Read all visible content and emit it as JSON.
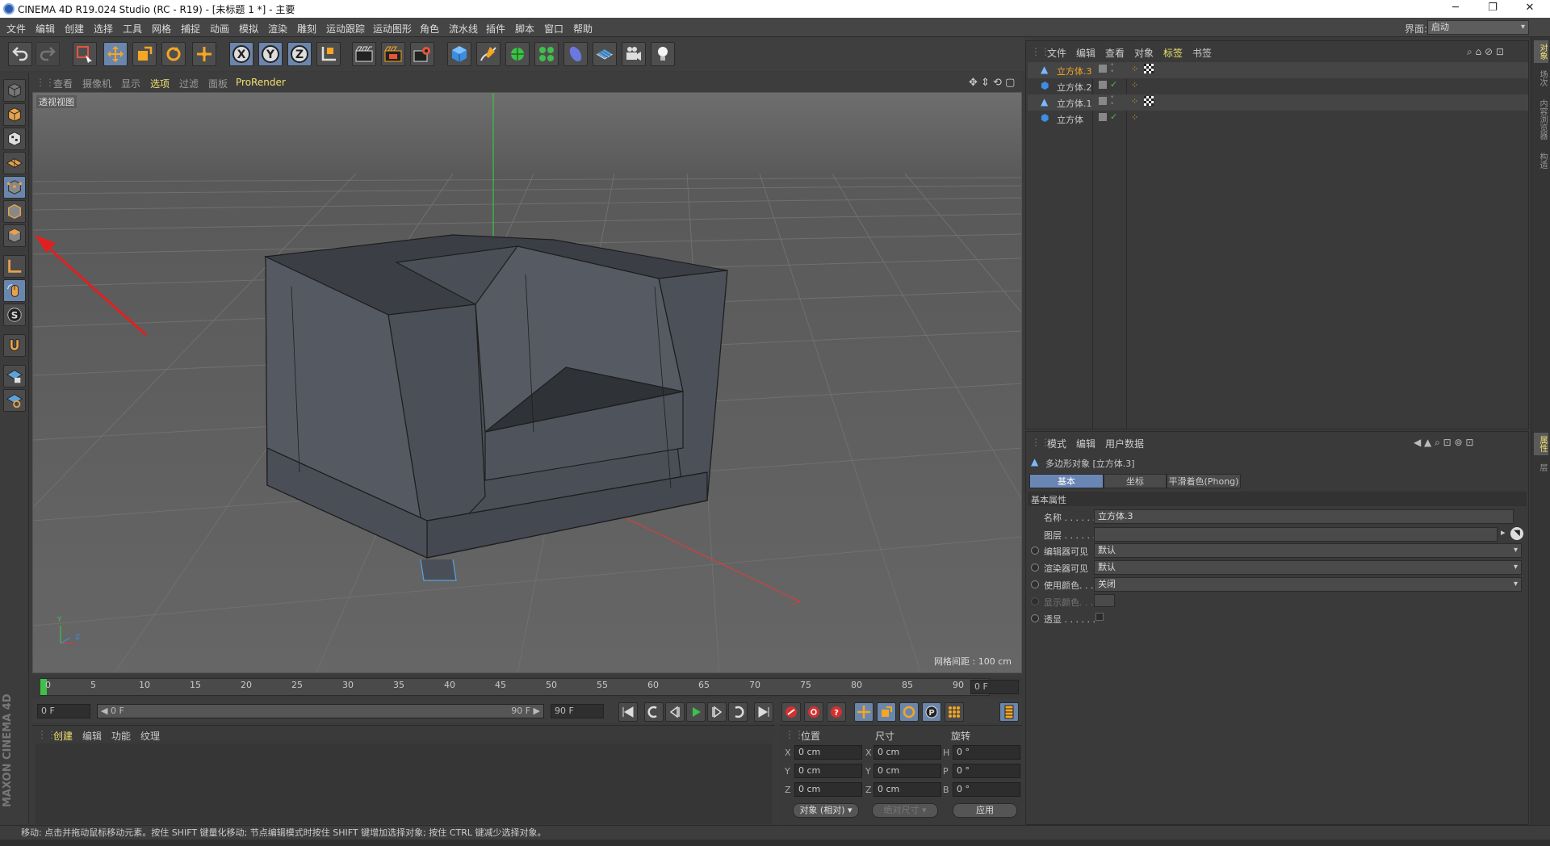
{
  "window": {
    "title": "CINEMA 4D R19.024 Studio (RC - R19) - [未标题 1 *] - 主要",
    "minimize": "─",
    "maximize": "❐",
    "close": "✕"
  },
  "menu": {
    "items": [
      "文件",
      "编辑",
      "创建",
      "选择",
      "工具",
      "网格",
      "捕捉",
      "动画",
      "模拟",
      "渲染",
      "雕刻",
      "运动跟踪",
      "运动图形",
      "角色",
      "流水线",
      "插件",
      "脚本",
      "窗口",
      "帮助"
    ],
    "layout_label": "界面:",
    "layout_value": "启动"
  },
  "toolbar": {
    "icons": [
      "undo-icon",
      "redo-icon",
      "live-selection-icon",
      "move-icon",
      "scale-icon",
      "rotate-icon",
      "recent-tool-icon",
      "x-axis-lock-icon",
      "y-axis-lock-icon",
      "z-axis-lock-icon",
      "coordinate-system-icon",
      "render-view-icon",
      "render-picture-viewer-icon",
      "render-settings-icon",
      "cube-primitive-icon",
      "pen-spline-icon",
      "subdivision-generator-icon",
      "cloner-icon",
      "deformer-icon",
      "floor-icon",
      "camera-icon",
      "light-icon"
    ],
    "axis_x": "X",
    "axis_y": "Y",
    "axis_z": "Z"
  },
  "left_tools": {
    "icons": [
      "make-editable-icon",
      "model-mode-icon",
      "texture-mode-icon",
      "workplane-icon",
      "points-mode-icon",
      "edges-mode-icon",
      "polygons-mode-icon",
      "enable-axis-icon",
      "tweak-mode-icon",
      "solo-icon",
      "snap-icon",
      "lock-workplane-icon",
      "planar-workplane-icon"
    ]
  },
  "viewport": {
    "menu": [
      "查看",
      "摄像机",
      "显示",
      "选项",
      "过滤",
      "面板",
      "ProRender"
    ],
    "active_menu": "选项",
    "label": "透视视图",
    "grid_spacing": "网格间距 : 100 cm",
    "axis_y": "Y",
    "axis_z": "Z"
  },
  "timeline": {
    "ticks": [
      "0",
      "5",
      "10",
      "15",
      "20",
      "25",
      "30",
      "35",
      "40",
      "45",
      "50",
      "55",
      "60",
      "65",
      "70",
      "75",
      "80",
      "85",
      "90"
    ],
    "current_frame": "0 F"
  },
  "playback": {
    "start_frame": "0 F",
    "range_start": "◀ 0 F",
    "range_end": "90 F ▶",
    "end_frame": "90 F"
  },
  "material_manager": {
    "menu": [
      "创建",
      "编辑",
      "功能",
      "纹理"
    ]
  },
  "coordinates": {
    "headers": [
      "位置",
      "尺寸",
      "旋转"
    ],
    "rows": [
      {
        "pos_label": "X",
        "pos": "0 cm",
        "size_label": "X",
        "size": "0 cm",
        "rot_label": "H",
        "rot": "0 °"
      },
      {
        "pos_label": "Y",
        "pos": "0 cm",
        "size_label": "Y",
        "size": "0 cm",
        "rot_label": "P",
        "rot": "0 °"
      },
      {
        "pos_label": "Z",
        "pos": "0 cm",
        "size_label": "Z",
        "size": "0 cm",
        "rot_label": "B",
        "rot": "0 °"
      }
    ],
    "mode_select": "对象 (相对)",
    "size_select": "绝对尺寸",
    "apply": "应用"
  },
  "status": {
    "text": "移动: 点击并拖动鼠标移动元素。按住 SHIFT 键量化移动; 节点编辑模式时按住 SHIFT 键增加选择对象; 按住 CTRL 键减少选择对象。"
  },
  "brand": {
    "text": "MAXON CINEMA 4D"
  },
  "object_manager": {
    "menu": [
      "文件",
      "编辑",
      "查看",
      "对象",
      "标签",
      "书签"
    ],
    "active_menu": "标签",
    "objects": [
      {
        "name": "立方体.3",
        "selected": true
      },
      {
        "name": "立方体.2",
        "selected": false
      },
      {
        "name": "立方体.1",
        "selected": false
      },
      {
        "name": "立方体",
        "selected": false
      }
    ]
  },
  "attributes": {
    "menu": [
      "模式",
      "编辑",
      "用户数据"
    ],
    "object_title": "多边形对象 [立方体.3]",
    "tabs": [
      "基本",
      "坐标",
      "平滑着色(Phong)"
    ],
    "active_tab": "基本",
    "section": "基本属性",
    "fields": {
      "name_label": "名称 . . . . . .",
      "name_value": "立方体.3",
      "layer_label": "图层 . . . . . .",
      "editor_visible_label": "编辑器可见",
      "editor_visible_value": "默认",
      "render_visible_label": "渲染器可见",
      "render_visible_value": "默认",
      "use_color_label": "使用颜色. . .",
      "use_color_value": "关闭",
      "display_color_label": "显示颜色. . .",
      "xray_label": "透显 . . . . . ."
    }
  },
  "right_tabs": [
    "对象",
    "内容浏览器",
    "构造",
    "场次",
    "属性",
    "层"
  ],
  "colors": {
    "selection_blue": "#6b86ad",
    "accent_orange": "#f5a623",
    "active_tab": "#6a86b4"
  }
}
